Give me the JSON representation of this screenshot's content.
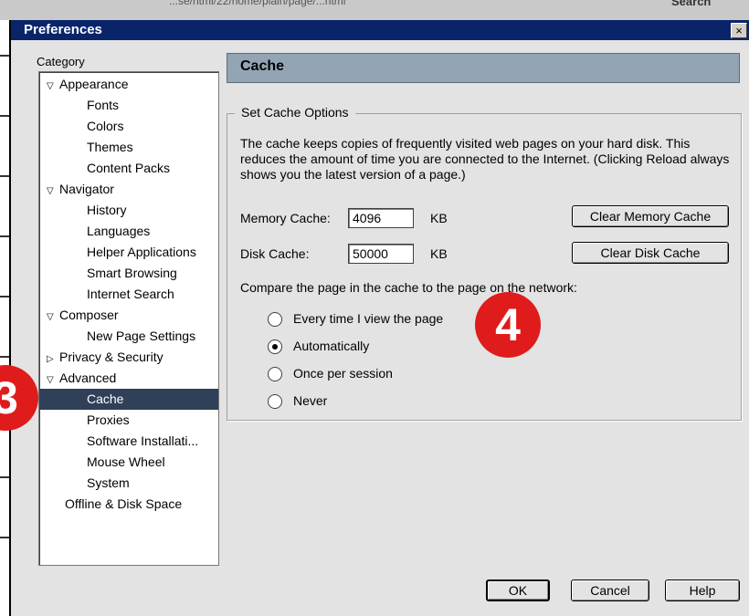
{
  "background": {
    "url_text": "...se/html/22/home/plain/page/...html",
    "search_label": "Search"
  },
  "dialog": {
    "title": "Preferences",
    "close_glyph": "×"
  },
  "category": {
    "label": "Category",
    "items": [
      {
        "label": "Appearance",
        "level": 0,
        "expander": "▽"
      },
      {
        "label": "Fonts",
        "level": 1
      },
      {
        "label": "Colors",
        "level": 1
      },
      {
        "label": "Themes",
        "level": 1
      },
      {
        "label": "Content Packs",
        "level": 1
      },
      {
        "label": "Navigator",
        "level": 0,
        "expander": "▽"
      },
      {
        "label": "History",
        "level": 1
      },
      {
        "label": "Languages",
        "level": 1
      },
      {
        "label": "Helper Applications",
        "level": 1
      },
      {
        "label": "Smart Browsing",
        "level": 1
      },
      {
        "label": "Internet Search",
        "level": 1
      },
      {
        "label": "Composer",
        "level": 0,
        "expander": "▽"
      },
      {
        "label": "New Page Settings",
        "level": 1
      },
      {
        "label": "Privacy & Security",
        "level": 0,
        "expander": "▷"
      },
      {
        "label": "Advanced",
        "level": 0,
        "expander": "▽"
      },
      {
        "label": "Cache",
        "level": 1,
        "selected": true
      },
      {
        "label": "Proxies",
        "level": 1
      },
      {
        "label": "Software Installati...",
        "level": 1
      },
      {
        "label": "Mouse Wheel",
        "level": 1
      },
      {
        "label": "System",
        "level": 1
      },
      {
        "label": "Offline & Disk Space",
        "level": 0
      }
    ]
  },
  "panel": {
    "title": "Cache",
    "group_title": "Set Cache Options",
    "description": "The cache keeps copies of frequently visited web pages on your hard disk. This reduces the amount of time you are connected to the Internet. (Clicking Reload always shows you the latest version of a page.)",
    "memory_cache": {
      "label": "Memory Cache:",
      "value": "4096",
      "unit": "KB",
      "button": "Clear Memory Cache"
    },
    "disk_cache": {
      "label": "Disk Cache:",
      "value": "50000",
      "unit": "KB",
      "button": "Clear Disk Cache"
    },
    "compare_label": "Compare the page in the cache to the page on the network:",
    "options": [
      {
        "label": "Every time I view the page",
        "selected": false
      },
      {
        "label": "Automatically",
        "selected": true
      },
      {
        "label": "Once per session",
        "selected": false
      },
      {
        "label": "Never",
        "selected": false
      }
    ]
  },
  "footer": {
    "ok": "OK",
    "cancel": "Cancel",
    "help": "Help"
  },
  "annotations": {
    "badge_3": "3",
    "badge_4": "4",
    "badge_color": "#e01b1b"
  }
}
